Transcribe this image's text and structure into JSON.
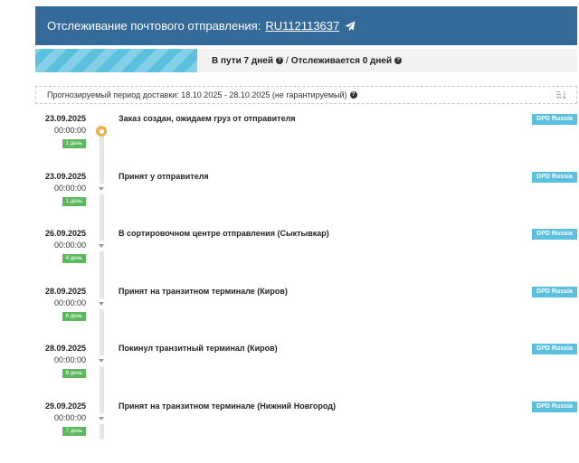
{
  "header": {
    "label": "Отслеживание почтового отправления:",
    "tracking_number": "RU112113637",
    "color": "#336a99"
  },
  "status": {
    "in_transit": "В пути 7 дней",
    "separator": "/",
    "tracked": "Отслеживается 0 дней"
  },
  "forecast": {
    "text": "Прогнозируемый период доставки: 18.10.2025 - 28.10.2025 (не гарантируемый)"
  },
  "events": [
    {
      "date": "23.09.2025",
      "time": "00:00:00",
      "days": "1 день",
      "title": "Заказ создан, ожидаем груз от отправителя",
      "carrier": "DPD Russia"
    },
    {
      "date": "23.09.2025",
      "time": "00:00:00",
      "days": "1 день",
      "title": "Принят у отправителя",
      "carrier": "DPD Russia"
    },
    {
      "date": "26.09.2025",
      "time": "00:00:00",
      "days": "4 день",
      "title": "В сортировочном центре отправления (Сыктывкар)",
      "carrier": "DPD Russia"
    },
    {
      "date": "28.09.2025",
      "time": "00:00:00",
      "days": "6 день",
      "title": "Принят на транзитном терминале (Киров)",
      "carrier": "DPD Russia"
    },
    {
      "date": "28.09.2025",
      "time": "00:00:00",
      "days": "6 день",
      "title": "Покинул транзитный терминал (Киров)",
      "carrier": "DPD Russia"
    },
    {
      "date": "29.09.2025",
      "time": "00:00:00",
      "days": "7 день",
      "title": "Принят на транзитном терминале (Нижний Новгород)",
      "carrier": "DPD Russia"
    }
  ],
  "icons": {
    "plane": "paper-plane-icon",
    "help": "question-circle-icon",
    "sort": "sort-amount-icon",
    "active_marker": "circle-marker-icon",
    "collapse_marker": "caret-down-icon"
  },
  "colors": {
    "accent": "#5bc0de",
    "days_badge": "#5cb85c",
    "active_marker": "#f0ad4e"
  }
}
